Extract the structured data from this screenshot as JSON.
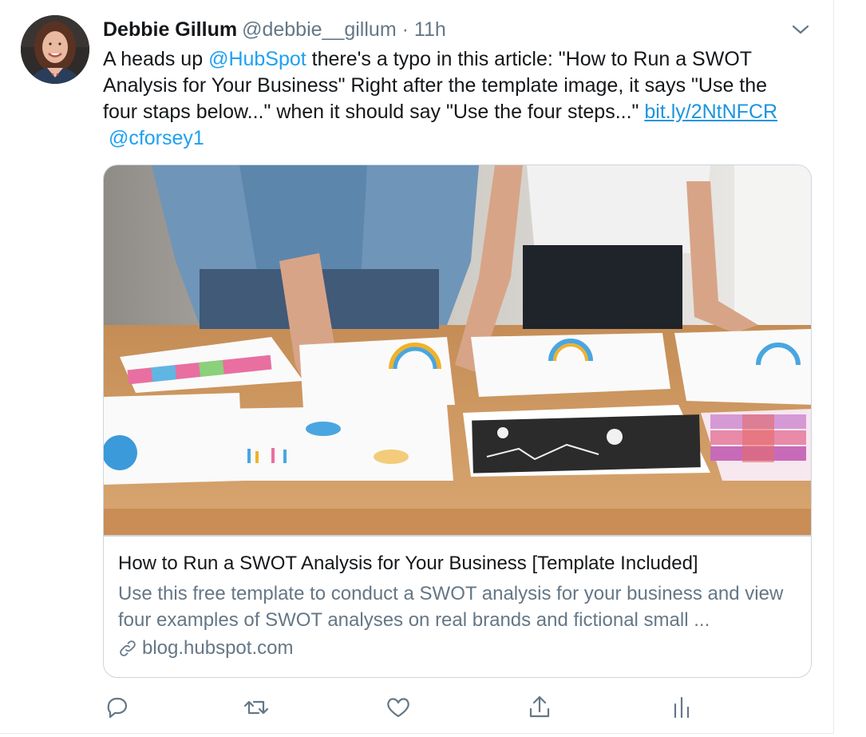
{
  "tweet": {
    "author_name": "Debbie Gillum",
    "author_handle": "@debbie__gillum",
    "separator": "·",
    "timestamp": "11h",
    "text_part1": "A heads up ",
    "mention1": "@HubSpot",
    "text_part2": " there's a typo in this article: \"How to Run a SWOT Analysis for Your Business\" Right after the template image, it says \"Use the four staps below...\" when it should say \"Use the four steps...\" ",
    "link_text": "bit.ly/2NtNFCR",
    "mention2": "@cforsey1"
  },
  "card": {
    "title": "How to Run a SWOT Analysis for Your Business [Template Included]",
    "description": "Use this free template to conduct a SWOT analysis for your business and view four examples of SWOT analyses on real brands and fictional small ...",
    "domain": "blog.hubspot.com"
  },
  "icons": {
    "more": "chevron-down-icon",
    "reply": "reply-icon",
    "retweet": "retweet-icon",
    "like": "heart-icon",
    "share": "share-icon",
    "analytics": "analytics-icon",
    "link": "link-icon"
  },
  "colors": {
    "accent": "#1da1f2",
    "link": "#1b95e0",
    "secondary_text": "#657786",
    "border": "#ccd6dd"
  }
}
